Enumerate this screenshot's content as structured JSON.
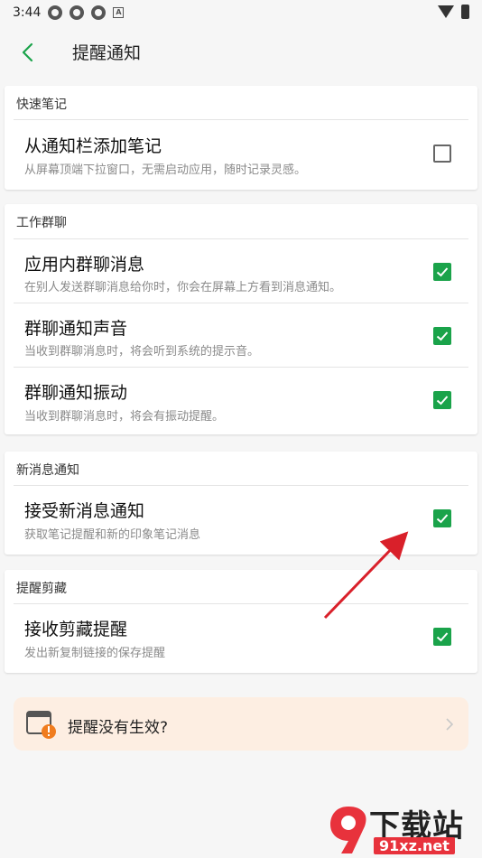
{
  "status_bar": {
    "time": "3:44"
  },
  "header": {
    "title": "提醒通知"
  },
  "sections": [
    {
      "title": "快速笔记",
      "items": [
        {
          "label": "从通知栏添加笔记",
          "desc": "从屏幕顶端下拉窗口，无需启动应用，随时记录灵感。",
          "checked": false
        }
      ]
    },
    {
      "title": "工作群聊",
      "items": [
        {
          "label": "应用内群聊消息",
          "desc": "在别人发送群聊消息给你时，你会在屏幕上方看到消息通知。",
          "checked": true
        },
        {
          "label": "群聊通知声音",
          "desc": "当收到群聊消息时，将会听到系统的提示音。",
          "checked": true
        },
        {
          "label": "群聊通知振动",
          "desc": "当收到群聊消息时，将会有振动提醒。",
          "checked": true
        }
      ]
    },
    {
      "title": "新消息通知",
      "items": [
        {
          "label": "接受新消息通知",
          "desc": "获取笔记提醒和新的印象笔记消息",
          "checked": true
        }
      ]
    },
    {
      "title": "提醒剪藏",
      "items": [
        {
          "label": "接收剪藏提醒",
          "desc": "发出新复制链接的保存提醒",
          "checked": true
        }
      ]
    }
  ],
  "tip": {
    "label": "提醒没有生效?"
  },
  "watermark": {
    "text": "下载站",
    "url": "91xz.net"
  },
  "colors": {
    "accent": "#1aa34a",
    "tip_bg": "#fdeee2",
    "annotation_arrow": "#d9202a"
  }
}
